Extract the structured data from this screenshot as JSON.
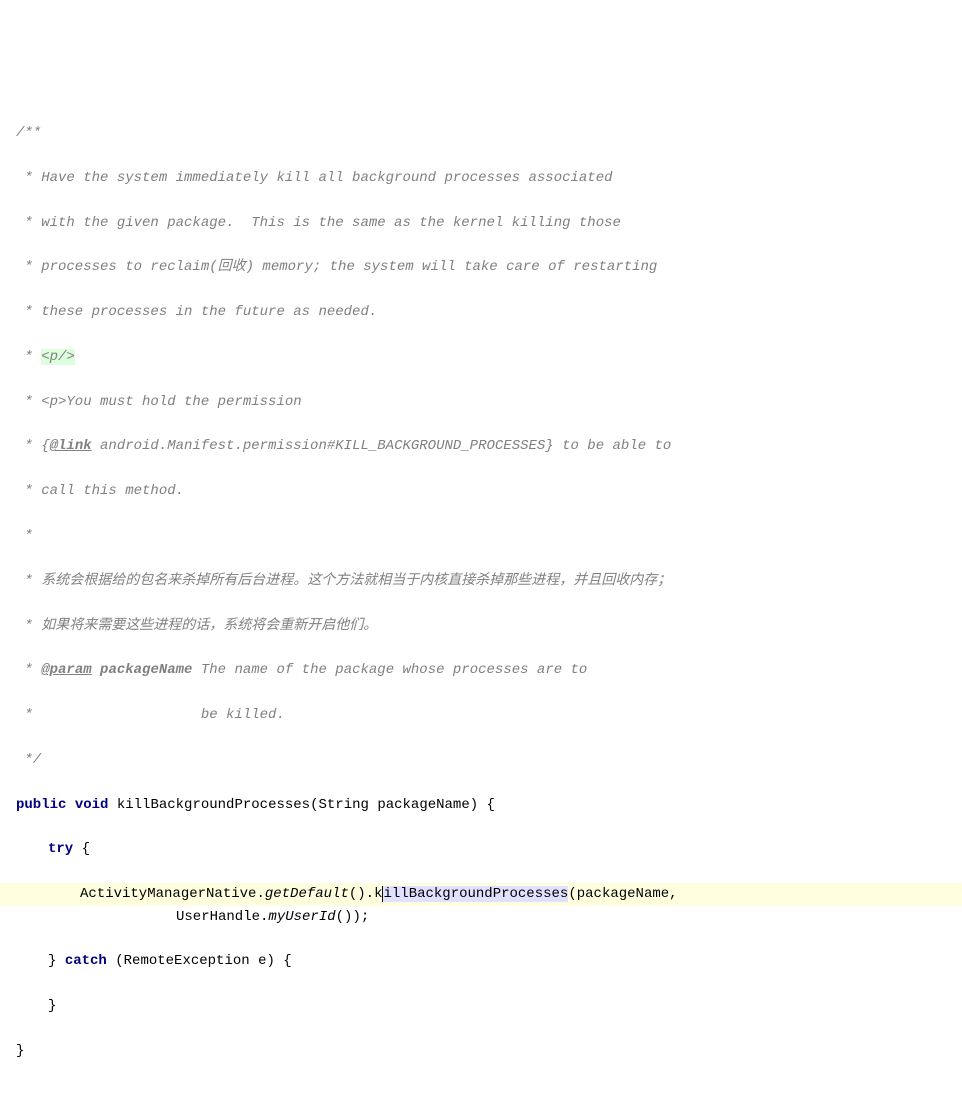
{
  "comment": {
    "start": "/**",
    "line1": " * Have the system immediately kill all background processes associated",
    "line2": " * with the given package.  This is the same as the kernel killing those",
    "line3": " * processes to reclaim(回收) memory; the system will take care of restarting",
    "line4": " * these processes in the future as needed.",
    "line5_prefix": " * ",
    "line5_tag": "<p/>",
    "line6": " * <p>You must hold the permission",
    "line7_prefix": " * {",
    "line7_tag": "@link",
    "line7_suffix": " android.Manifest.permission#KILL_BACKGROUND_PROCESSES} to be able to",
    "line8": " * call this method.",
    "line9": " *",
    "line10": " * 系统会根据给的包名来杀掉所有后台进程。这个方法就相当于内核直接杀掉那些进程，并且回收内存；",
    "line11": " * 如果将来需要这些进程的话，系统将会重新开启他们。",
    "line12_prefix": " * ",
    "line12_tag": "@param",
    "line12_param": " packageName",
    "line12_desc": " The name of the package whose processes are to",
    "line13": " *                    be killed.",
    "end": " */"
  },
  "code": {
    "method_signature_public": "public",
    "method_signature_void": "void",
    "method_name": "killBackgroundProcesses",
    "method_param_type": "String",
    "method_param_name": "packageName",
    "try_keyword": "try",
    "call_class1": "ActivityManagerNative",
    "call_method1": "getDefault",
    "call_method2_prefix": "k",
    "call_method2_selected": "illBackgroundProcesses",
    "call_arg1": "packageName",
    "call_class2": "UserHandle",
    "call_method3": "myUserId",
    "catch_keyword": "catch",
    "catch_type": "RemoteException",
    "catch_var": "e"
  }
}
